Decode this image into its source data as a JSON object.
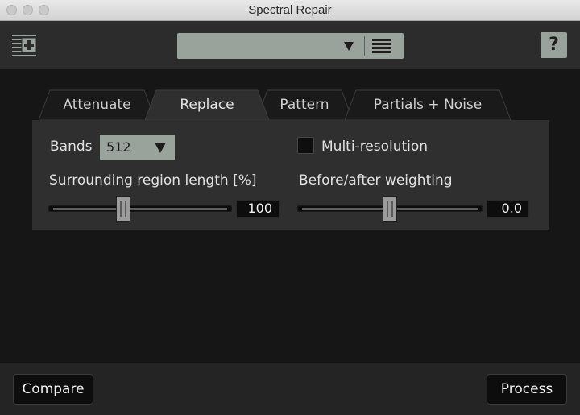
{
  "window": {
    "title": "Spectral Repair"
  },
  "header": {
    "module_icon": "spectral-repair-module-icon",
    "preset_value": "",
    "preset_arrow_icon": "triangle-down-icon",
    "preset_menu_icon": "hamburger-menu-icon",
    "help_label": "?"
  },
  "tabs": [
    {
      "label": "Attenuate",
      "active": false
    },
    {
      "label": "Replace",
      "active": true
    },
    {
      "label": "Pattern",
      "active": false
    },
    {
      "label": "Partials + Noise",
      "active": false
    }
  ],
  "panel": {
    "bands_label": "Bands",
    "bands_value": "512",
    "multires_label": "Multi-resolution",
    "multires_checked": false,
    "surrounding_label": "Surrounding region length [%]",
    "surrounding_value": "100",
    "surrounding_level": 0.4,
    "weighting_label": "Before/after weighting",
    "weighting_value": "0.0",
    "weighting_level": 0.5
  },
  "footer": {
    "compare_label": "Compare",
    "process_label": "Process"
  },
  "colors": {
    "background": "#161616",
    "panel": "#2f2f2f",
    "control_accent": "#9aa39b",
    "titlebar": "#dedede"
  }
}
